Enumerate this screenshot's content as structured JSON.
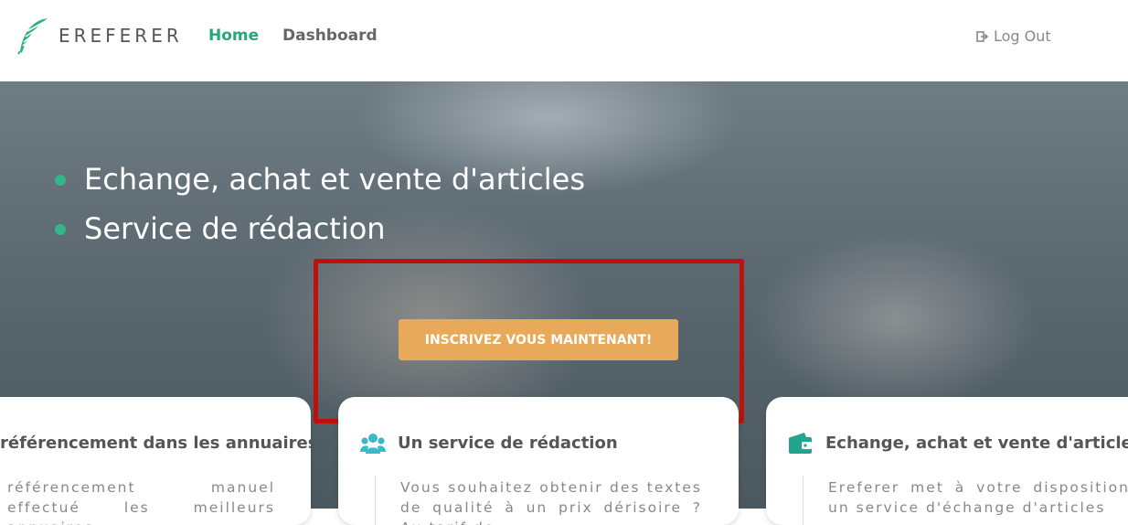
{
  "header": {
    "brand": "EREFERER",
    "nav": [
      {
        "label": "Home"
      },
      {
        "label": "Dashboard"
      }
    ],
    "logout_label": "Log Out"
  },
  "hero": {
    "bullets": [
      "Echange, achat et vente d'articles",
      "Service de rédaction"
    ],
    "cta_label": "INSCRIVEZ VOUS MAINTENANT!"
  },
  "cards": [
    {
      "title": "référencement dans les annuaires",
      "text": "référencement manuel effectué les meilleurs annuaires"
    },
    {
      "title": "Un service de rédaction",
      "text": "Vous souhaitez obtenir des textes de qualité à un prix dérisoire ? Au tarif de"
    },
    {
      "title": "Echange, achat et vente d'articles",
      "text": "Ereferer met à votre disposition un service d'échange d'articles"
    }
  ],
  "colors": {
    "accent_green": "#27a67a",
    "cta_orange": "#e8a95a",
    "highlight_red": "#c0100c",
    "icon_teal": "#3bb8c9"
  }
}
